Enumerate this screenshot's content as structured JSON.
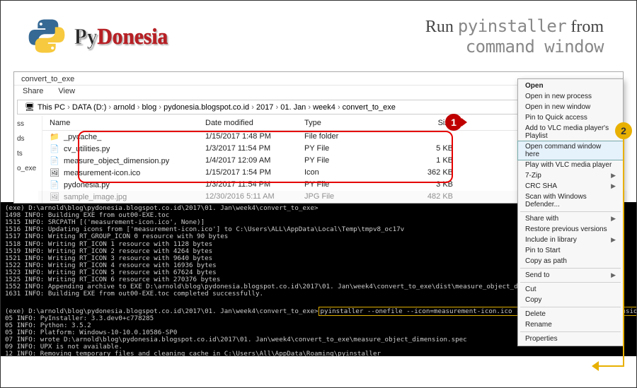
{
  "slide_title": {
    "prefix": "Run ",
    "mono1": "pyinstaller",
    "mid": " from",
    "mono2": "command window"
  },
  "logo": {
    "py": "Py",
    "donesia": "Donesia"
  },
  "explorer": {
    "window_title": "convert_to_exe",
    "menu": {
      "share": "Share",
      "view": "View"
    },
    "path_label": "This PC",
    "path": [
      "This PC",
      "DATA (D:)",
      "arnold",
      "blog",
      "pydonesia.blogspot.co.id",
      "2017",
      "01. Jan",
      "week4",
      "convert_to_exe"
    ],
    "nav_items": [
      "ss",
      "ds",
      "ts",
      "o_exe"
    ],
    "columns": {
      "name": "Name",
      "date": "Date modified",
      "type": "Type",
      "size": "Size"
    },
    "rows": [
      {
        "icon": "📁",
        "name": "_pycache_",
        "date": "1/15/2017 1:48 PM",
        "type": "File folder",
        "size": ""
      },
      {
        "icon": "📄",
        "name": "cv_utilities.py",
        "date": "1/3/2017 11:54 PM",
        "type": "PY File",
        "size": "5 KB"
      },
      {
        "icon": "📄",
        "name": "measure_object_dimension.py",
        "date": "1/4/2017 12:09 AM",
        "type": "PY File",
        "size": "1 KB"
      },
      {
        "icon": "🖼",
        "name": "measurement-icon.ico",
        "date": "1/15/2017 1:54 PM",
        "type": "Icon",
        "size": "362 KB"
      },
      {
        "icon": "📄",
        "name": "pydonesia.py",
        "date": "1/3/2017 11:54 PM",
        "type": "PY File",
        "size": "3 KB"
      },
      {
        "icon": "🖼",
        "name": "sample_image.jpg",
        "date": "12/30/2016 5:11 AM",
        "type": "JPG File",
        "size": "482 KB"
      }
    ]
  },
  "context_menu": {
    "groups": [
      [
        {
          "t": "Open",
          "bold": true
        },
        {
          "t": "Open in new process"
        },
        {
          "t": "Open in new window"
        },
        {
          "t": "Pin to Quick access"
        },
        {
          "t": "Add to VLC media player's Playlist"
        },
        {
          "t": "Open command window here",
          "hl": true
        },
        {
          "t": "Play with VLC media player"
        },
        {
          "t": "7-Zip",
          "sub": true
        },
        {
          "t": "CRC SHA",
          "sub": true
        },
        {
          "t": "Scan with Windows Defender..."
        }
      ],
      [
        {
          "t": "Share with",
          "sub": true
        },
        {
          "t": "Restore previous versions"
        },
        {
          "t": "Include in library",
          "sub": true
        },
        {
          "t": "Pin to Start"
        },
        {
          "t": "Copy as path"
        }
      ],
      [
        {
          "t": "Send to",
          "sub": true
        }
      ],
      [
        {
          "t": "Cut"
        },
        {
          "t": "Copy"
        }
      ],
      [
        {
          "t": "Delete"
        },
        {
          "t": "Rename"
        }
      ],
      [
        {
          "t": "Properties"
        }
      ]
    ]
  },
  "badges": {
    "one": "1",
    "two": "2"
  },
  "console_lines": [
    "(exe) D:\\arnold\\blog\\pydonesia.blogspot.co.id\\2017\\01. Jan\\week4\\convert_to_exe>",
    "1498 INFO: Building EXE from out00-EXE.toc",
    "1515 INFO: SRCPATH [('measurement-icon.ico', None)]",
    "1516 INFO: Updating icons from ['measurement-icon.ico'] to C:\\Users\\ALL\\AppData\\Local\\Temp\\tmpv8_oc17v",
    "1517 INFO: Writing RT_GROUP_ICON 0 resource with 90 bytes",
    "1518 INFO: Writing RT_ICON 1 resource with 1128 bytes",
    "1519 INFO: Writing RT_ICON 2 resource with 4264 bytes",
    "1521 INFO: Writing RT_ICON 3 resource with 9640 bytes",
    "1522 INFO: Writing RT_ICON 4 resource with 16936 bytes",
    "1523 INFO: Writing RT_ICON 5 resource with 67624 bytes",
    "1525 INFO: Writing RT_ICON 6 resource with 270376 bytes",
    "1552 INFO: Appending archive to EXE D:\\arnold\\blog\\pydonesia.blogspot.co.id\\2017\\01. Jan\\week4\\convert_to_exe\\dist\\measure_object_dimension.exe",
    "1631 INFO: Building EXE from out00-EXE.toc completed successfully."
  ],
  "console_prompt": "(exe) D:\\arnold\\blog\\pydonesia.blogspot.co.id\\2017\\01. Jan\\week4\\convert_to_exe>",
  "console_cmd_inline": "pyinstaller --onefile --icon=measurement-icon.ico --clean measure_object_dimension.py",
  "console_followup": [
    "05 INFO: PyInstaller: 3.3.dev0+c778285",
    "05 INFO: Python: 3.5.2",
    "05 INFO: Platform: Windows-10-10.0.10586-SP0",
    "07 INFO: wrote D:\\arnold\\blog\\pydonesia.blogspot.co.id\\2017\\01. Jan\\week4\\convert_to_exe\\measure_object_dimension.spec",
    "09 INFO: UPX is not available.",
    "12 INFO: Removing temporary files and cleaning cache in C:\\Users\\All\\AppData\\Roaming\\pyinstaller"
  ],
  "bottom_command": "pyinstaller --onefile --icon=measurement-icon.ico --clean measure_object_dimension.py"
}
